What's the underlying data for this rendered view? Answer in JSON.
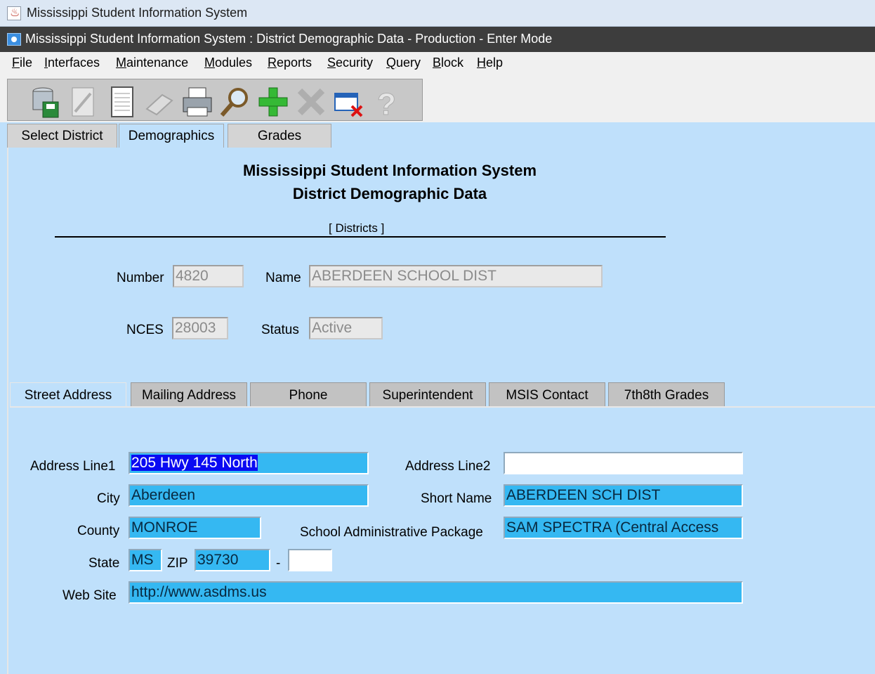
{
  "outer_window": {
    "title": "Mississippi Student Information System"
  },
  "inner_window": {
    "title": "Mississippi Student Information System : District Demographic Data  -  Production  -  Enter Mode"
  },
  "menu": [
    "File",
    "Interfaces",
    "Maintenance",
    "Modules",
    "Reports",
    "Security",
    "Query",
    "Block",
    "Help"
  ],
  "toolbar": {
    "buttons": [
      "save-icon",
      "edit-icon",
      "notes-icon",
      "eraser-icon",
      "print-icon",
      "search-icon",
      "add-icon",
      "delete-icon",
      "close-window-icon",
      "help-icon"
    ]
  },
  "main_tabs": [
    "Select District",
    "Demographics",
    "Grades"
  ],
  "header": {
    "title": "Mississippi Student Information System",
    "subtitle": "District Demographic Data",
    "section": "[ Districts ]"
  },
  "district": {
    "number_label": "Number",
    "number_value": "4820",
    "name_label": "Name",
    "name_value": "ABERDEEN SCHOOL DIST",
    "nces_label": "NCES",
    "nces_value": "28003",
    "status_label": "Status",
    "status_value": "Active"
  },
  "sub_tabs": [
    "Street Address",
    "Mailing Address",
    "Phone",
    "Superintendent",
    "MSIS Contact",
    "7th8th Grades"
  ],
  "address": {
    "line1_label": "Address Line1",
    "line1_value": "205 Hwy 145 North",
    "line2_label": "Address Line2",
    "line2_value": "",
    "city_label": "City",
    "city_value": "Aberdeen",
    "short_name_label": "Short Name",
    "short_name_value": "ABERDEEN SCH DIST",
    "county_label": "County",
    "county_value": "MONROE",
    "sap_label": "School Administrative Package",
    "sap_value": "SAM SPECTRA (Central Access",
    "state_label": "State",
    "state_value": "MS",
    "zip_label": "ZIP",
    "zip_value": "39730",
    "zip_sep": "-",
    "zip_ext_value": "",
    "website_label": "Web Site",
    "website_value": "http://www.asdms.us"
  }
}
